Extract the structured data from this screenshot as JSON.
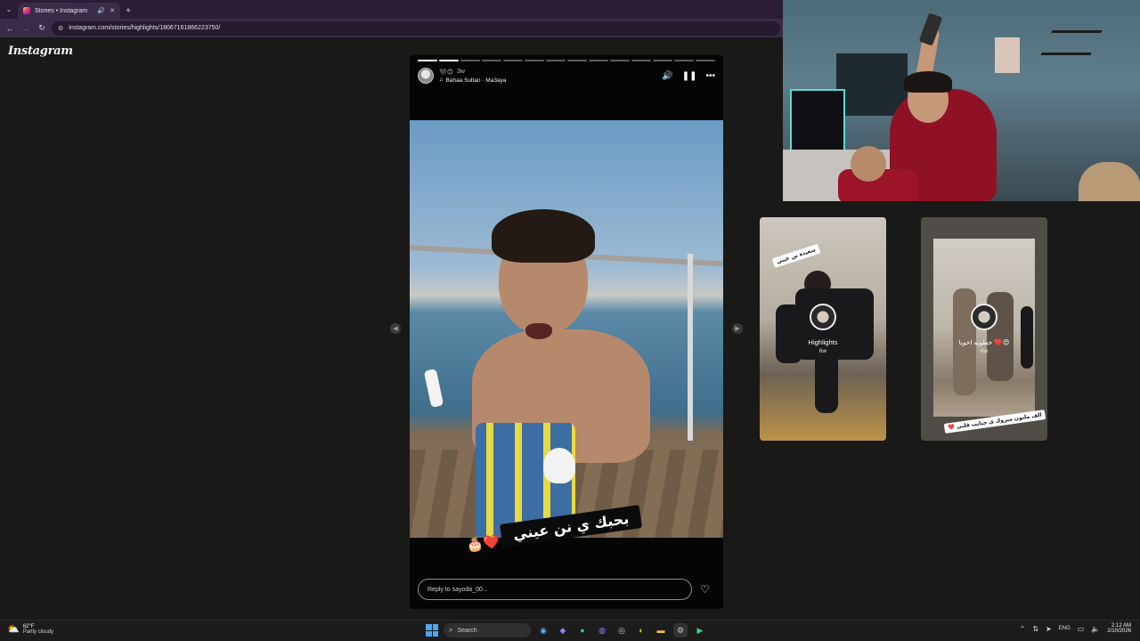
{
  "browser": {
    "tab": {
      "title": "Stories • Instagram",
      "audio_icon": "speaker-icon",
      "close_icon": "close-icon"
    },
    "url": "instagram.com/stories/highlights/18067161866223750/",
    "new_tab_symbol": "+",
    "menu_symbol": "⌄",
    "back_symbol": "←",
    "forward_symbol": "→",
    "reload_symbol": "↻"
  },
  "page": {
    "logo": "Instagram"
  },
  "story": {
    "segments_total": 14,
    "segments_done": 2,
    "time_ago": "3w",
    "music": "Bahaa Sultan · Ma3aya",
    "caption": "بحبك ي نن عيني",
    "caption_emojis": "🎂❤️",
    "reply_placeholder": "Reply to sayoda_00...",
    "volume_icon": "speaker-icon",
    "pause_icon": "pause-icon",
    "more_icon": "more-icon",
    "like_icon": "heart-icon"
  },
  "previews": [
    {
      "label": "Highlights",
      "time": "6w",
      "tag": "سعيدة نن عيني"
    },
    {
      "label": "خطوبه اخويا ❤️😍",
      "time": "6w",
      "tag": "الف مليون مبروك ي حبايب قلبي ❤️"
    }
  ],
  "taskbar": {
    "weather_temp": "62°F",
    "weather_desc": "Partly cloudy",
    "search": "Search",
    "lang": "ENG",
    "time": "2:12 AM",
    "date": "2/10/2026"
  },
  "colors": {
    "page_bg": "#191917",
    "browser_tabbar": "#2a1d34",
    "browser_toolbar": "#3a2c47"
  }
}
